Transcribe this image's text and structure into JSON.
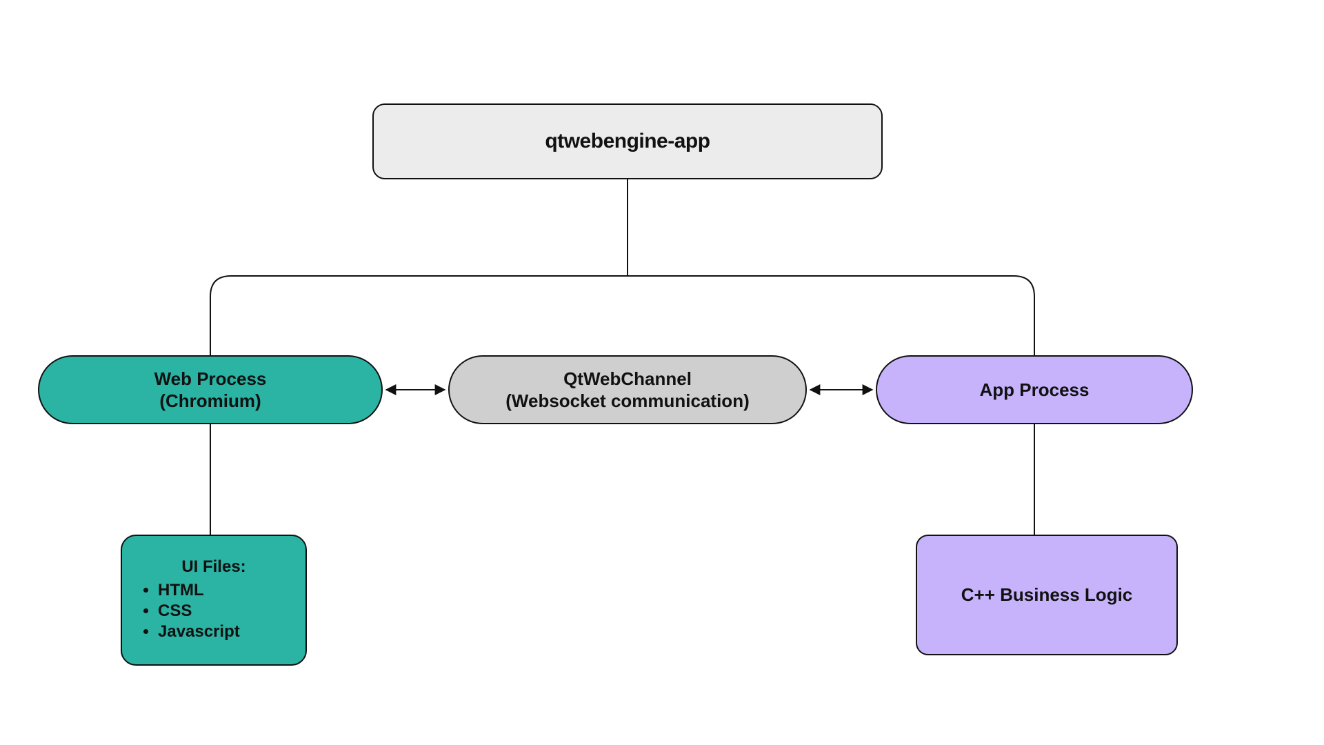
{
  "colors": {
    "teal": "#2bb3a3",
    "purple": "#c6b3fb",
    "grey": "#cfcfcf",
    "lightgrey": "#ececec",
    "line": "#111111"
  },
  "nodes": {
    "root": {
      "label": "qtwebengine-app"
    },
    "web_process": {
      "line1": "Web Process",
      "line2": "(Chromium)"
    },
    "qtwebchannel": {
      "line1": "QtWebChannel",
      "line2": "(Websocket communication)"
    },
    "app_process": {
      "label": "App Process"
    },
    "ui_files": {
      "title": "UI Files:",
      "items": [
        "HTML",
        "CSS",
        "Javascript"
      ]
    },
    "cpp": {
      "label": "C++ Business Logic"
    }
  },
  "edges": [
    {
      "from": "root",
      "to": "web_process",
      "style": "tree"
    },
    {
      "from": "root",
      "to": "app_process",
      "style": "tree"
    },
    {
      "from": "web_process",
      "to": "qtwebchannel",
      "style": "bidirectional"
    },
    {
      "from": "qtwebchannel",
      "to": "app_process",
      "style": "bidirectional"
    },
    {
      "from": "web_process",
      "to": "ui_files",
      "style": "line"
    },
    {
      "from": "app_process",
      "to": "cpp",
      "style": "line"
    }
  ]
}
